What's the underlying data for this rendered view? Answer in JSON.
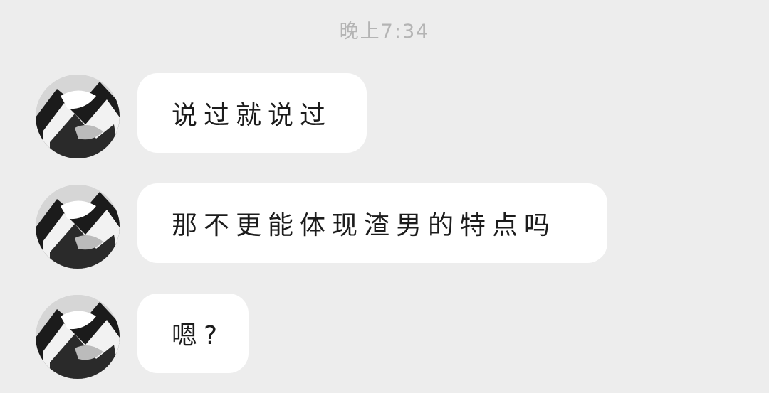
{
  "chat": {
    "timestamp": "晚上7:34",
    "messages": [
      {
        "sender": "other",
        "avatar_icon": "user-avatar-icon",
        "text": "说过就说过"
      },
      {
        "sender": "other",
        "avatar_icon": "user-avatar-icon",
        "text": "那不更能体现渣男的特点吗"
      },
      {
        "sender": "other",
        "avatar_icon": "user-avatar-icon",
        "text": "嗯?"
      }
    ]
  },
  "colors": {
    "background": "#ededed",
    "bubble": "#ffffff",
    "timestamp_text": "#b4b4b4"
  }
}
